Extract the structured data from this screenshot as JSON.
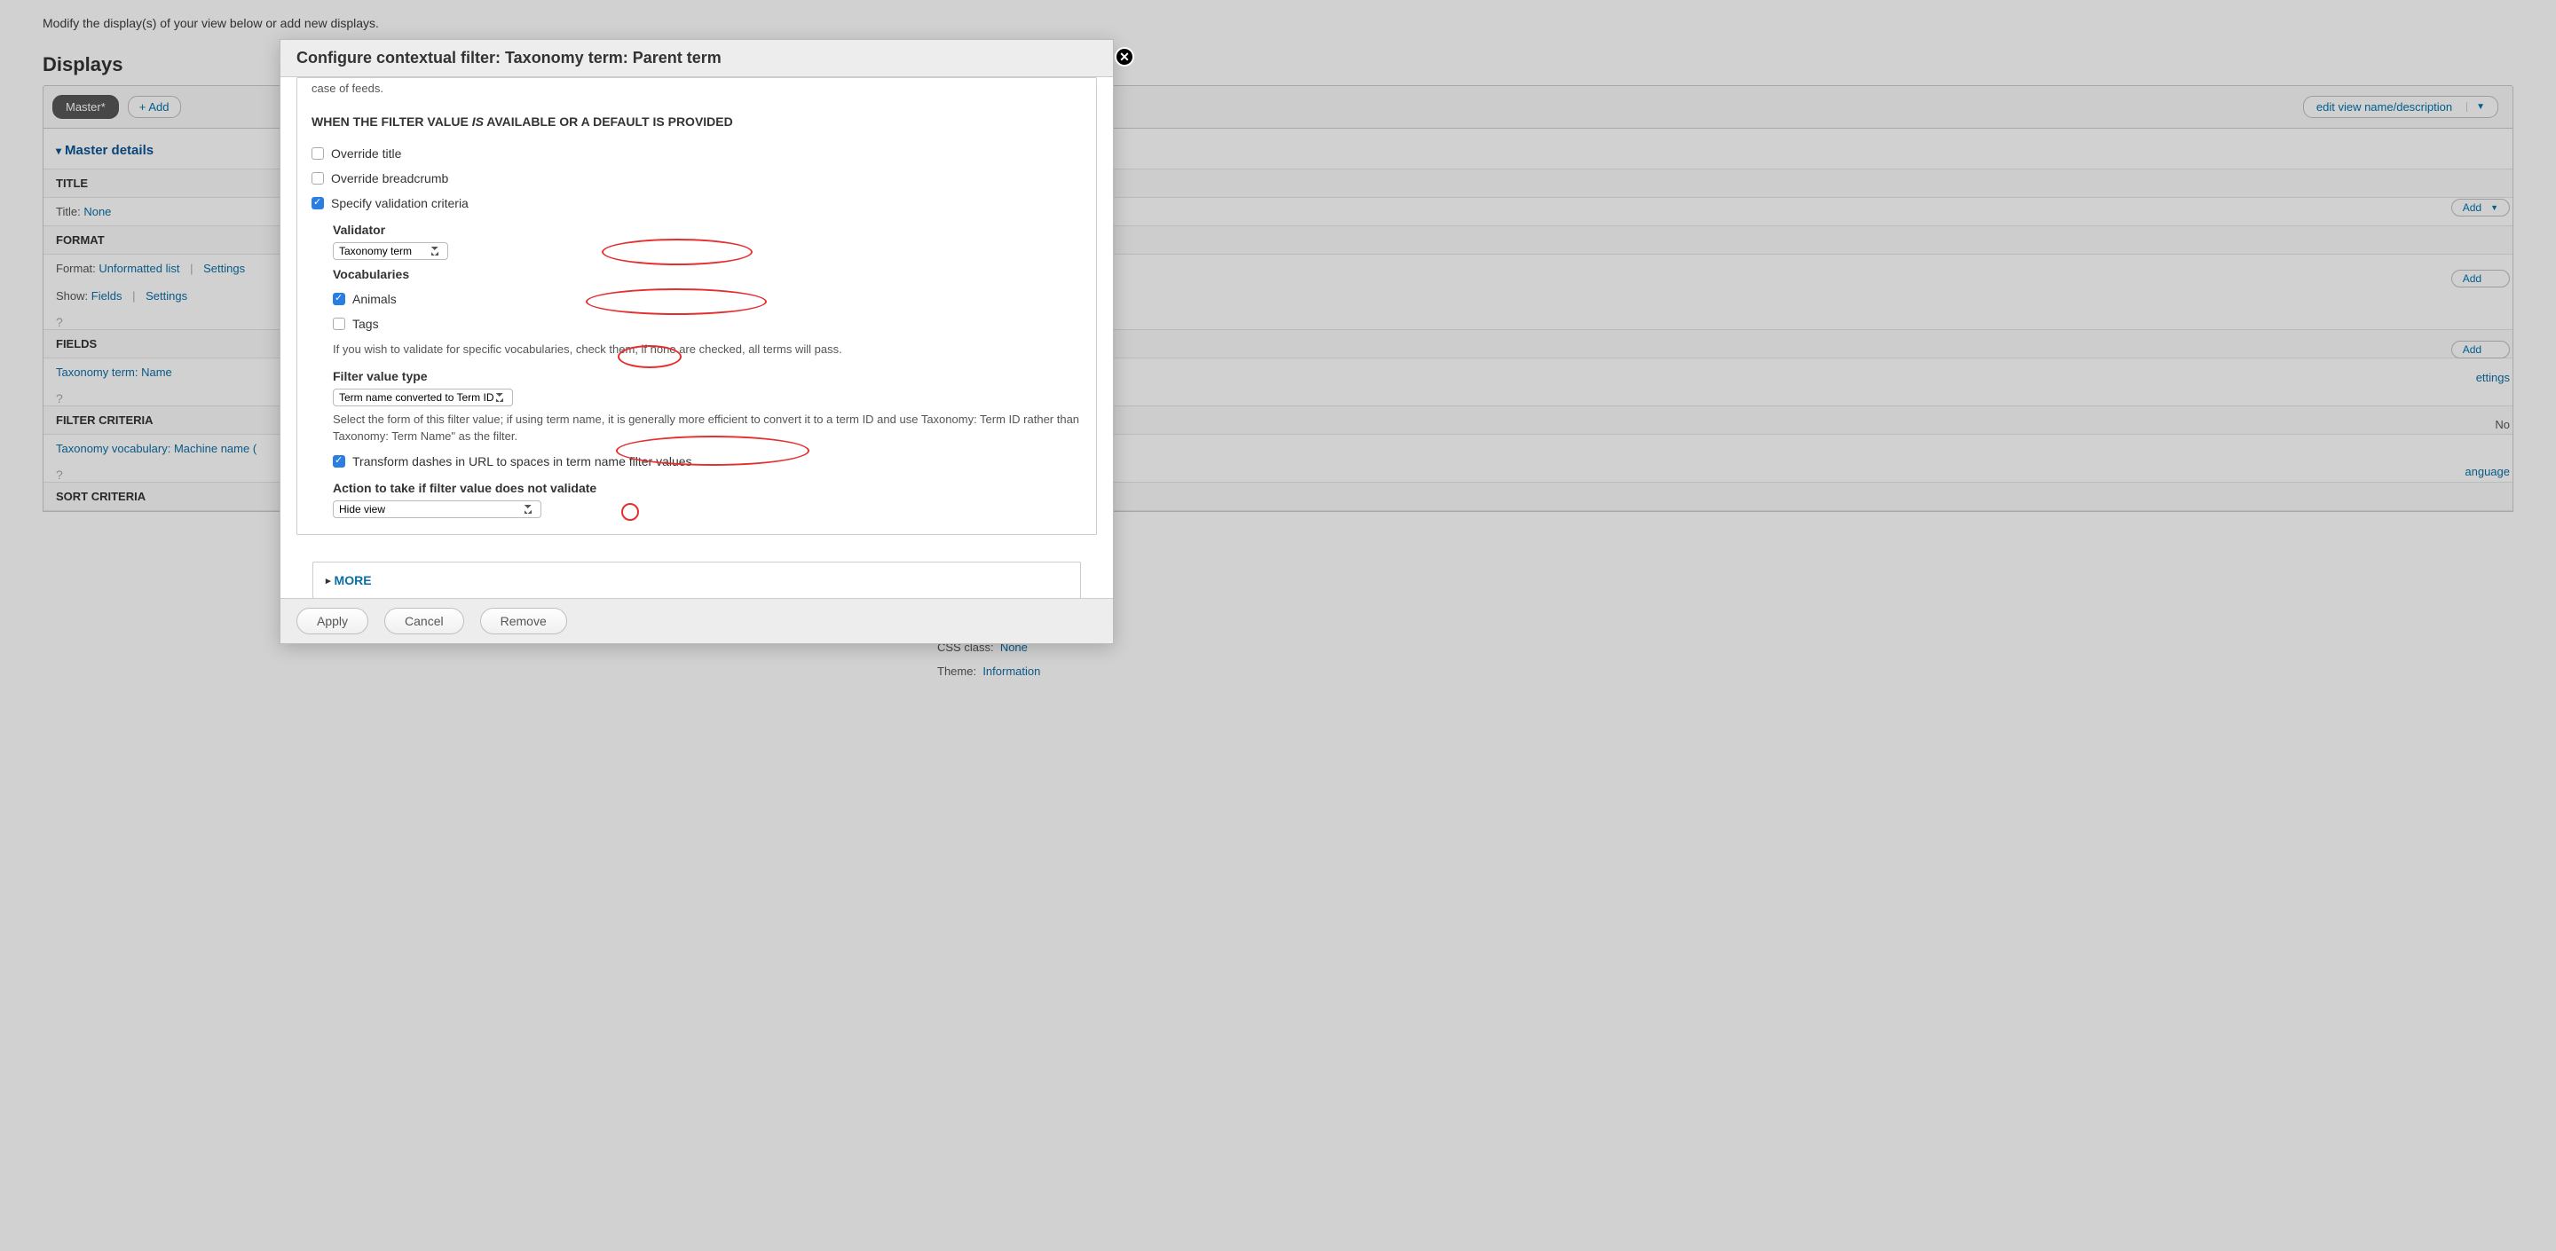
{
  "page": {
    "intro": "Modify the display(s) of your view below or add new displays."
  },
  "displays": {
    "heading": "Displays",
    "master_tab": "Master*",
    "add_tab": "Add",
    "edit_view_label": "edit view name/description"
  },
  "details": {
    "toggle_label": "Master details",
    "title_header": "TITLE",
    "title_label": "Title:",
    "title_value": "None",
    "format_header": "FORMAT",
    "format_label": "Format:",
    "format_value": "Unformatted list",
    "format_settings": "Settings",
    "show_label": "Show:",
    "show_value": "Fields",
    "show_settings": "Settings",
    "fields_header": "FIELDS",
    "fields_value": "Taxonomy term: Name",
    "filter_header": "FILTER CRITERIA",
    "filter_value_prefix": "Taxonomy vocabulary: Machine name (",
    "sort_header": "SORT CRITERIA",
    "add_label": "Add",
    "settings_word": "ettings",
    "no_word": "No",
    "language_word": "anguage",
    "css_label": "CSS class:",
    "css_value": "None",
    "theme_label": "Theme:",
    "theme_value": "Information"
  },
  "dialog": {
    "title": "Configure contextual filter: Taxonomy term: Parent term",
    "trail_text": "case of feeds.",
    "heading_before": "WHEN THE FILTER VALUE ",
    "heading_is": "IS",
    "heading_after": " AVAILABLE OR A DEFAULT IS PROVIDED",
    "override_title": "Override title",
    "override_breadcrumb": "Override breadcrumb",
    "specify_validation": "Specify validation criteria",
    "validator_label": "Validator",
    "validator_value": "Taxonomy term",
    "vocab_label": "Vocabularies",
    "vocab_animals": "Animals",
    "vocab_tags": "Tags",
    "vocab_desc": "If you wish to validate for specific vocabularies, check them; if none are checked, all terms will pass.",
    "filter_value_type_label": "Filter value type",
    "filter_value_type_value": "Term name converted to Term ID",
    "filter_value_type_desc": "Select the form of this filter value; if using term name, it is generally more efficient to convert it to a term ID and use Taxonomy: Term ID rather than Taxonomy: Term Name\" as the filter.",
    "transform_dashes": "Transform dashes in URL to spaces in term name filter values",
    "action_label": "Action to take if filter value does not validate",
    "action_value": "Hide view",
    "more_label": "MORE",
    "apply": "Apply",
    "cancel": "Cancel",
    "remove": "Remove"
  }
}
